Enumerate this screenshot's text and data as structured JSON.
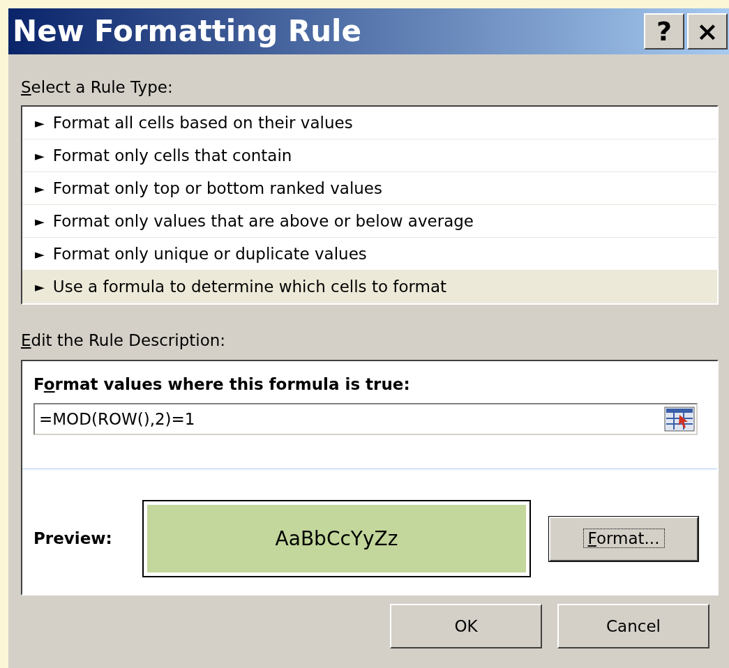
{
  "window": {
    "title": "New Formatting Rule",
    "title_buttons": [
      "?",
      "×"
    ]
  },
  "rule_type": {
    "label": [
      {
        "text": "S",
        "underlined": true
      },
      {
        "text": "elect a Rule Type:",
        "underlined": false
      }
    ],
    "items": [
      {
        "marker": "►",
        "text": "Format all cells based on their values",
        "selected": false
      },
      {
        "marker": "►",
        "text": "Format only cells that contain",
        "selected": false
      },
      {
        "marker": "►",
        "text": "Format only top or bottom ranked values",
        "selected": false
      },
      {
        "marker": "►",
        "text": "Format only values that are above or below average",
        "selected": false
      },
      {
        "marker": "►",
        "text": "Format only unique or duplicate values",
        "selected": false
      },
      {
        "marker": "►",
        "text": "Use a formula to determine which cells to format",
        "selected": true
      }
    ]
  },
  "description": {
    "label": [
      {
        "text": "E",
        "underlined": true
      },
      {
        "text": "dit the Rule Description:",
        "underlined": false
      }
    ],
    "formula_label": [
      {
        "text": "F",
        "underlined": false
      },
      {
        "text": "o",
        "underlined": true
      },
      {
        "text": "rmat values where this formula is true:",
        "underlined": false
      }
    ],
    "formula": {
      "value": "=MOD(ROW(),2)=1"
    },
    "preview": {
      "label": "Preview:",
      "sample": "AaBbCcYyZz",
      "color": "#c3d69b"
    },
    "format_button": [
      {
        "text": "F",
        "underlined": true
      },
      {
        "text": "ormat...",
        "underlined": false
      }
    ]
  },
  "buttons": [
    "OK",
    "Cancel"
  ]
}
